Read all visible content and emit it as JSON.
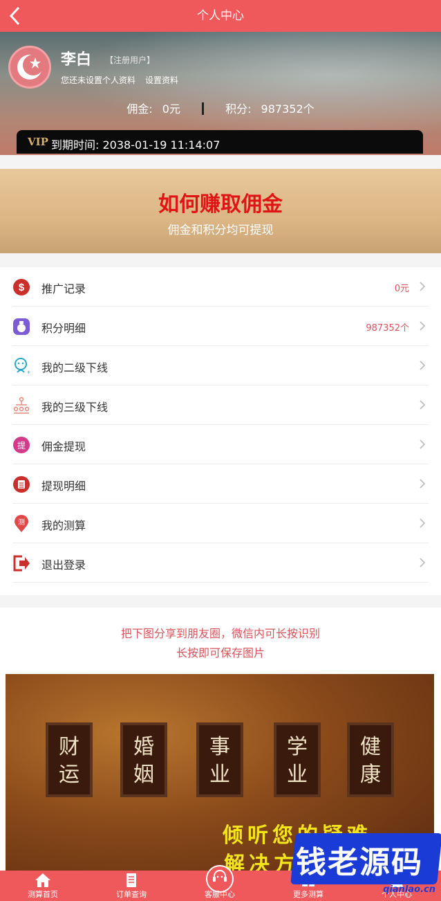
{
  "header": {
    "title": "个人中心"
  },
  "profile": {
    "name": "李白",
    "badge": "【注册用户】",
    "hint": "您还未设置个人资料",
    "setup_link": "设置资料",
    "commission_label": "佣金:",
    "commission_value": "0元",
    "points_label": "积分:",
    "points_value": "987352个",
    "vip_label": "VIP",
    "expire": "到期时间: 2038-01-19 11:14:07"
  },
  "banner": {
    "title": "如何赚取佣金",
    "subtitle": "佣金和积分均可提现"
  },
  "menu": [
    {
      "label": "推广记录",
      "value": "0元",
      "icon": "dollar-icon",
      "color": "#c9302c"
    },
    {
      "label": "积分明细",
      "value": "987352个",
      "icon": "money-bag-icon",
      "color": "#7b5bd6"
    },
    {
      "label": "我的二级下线",
      "value": "",
      "icon": "user-add-icon",
      "color": "#2aa6c7"
    },
    {
      "label": "我的三级下线",
      "value": "",
      "icon": "org-tree-icon",
      "color": "#e5857a"
    },
    {
      "label": "佣金提现",
      "value": "",
      "icon": "withdraw-icon",
      "color": "#d33a8a"
    },
    {
      "label": "提现明细",
      "value": "",
      "icon": "list-icon",
      "color": "#c9302c"
    },
    {
      "label": "我的测算",
      "value": "",
      "icon": "location-pin-icon",
      "color": "#e04848"
    },
    {
      "label": "退出登录",
      "value": "",
      "icon": "logout-icon",
      "color": "#c9302c"
    }
  ],
  "share": {
    "line1": "把下图分享到朋友圈，微信内可长按识别",
    "line2": "长按即可保存图片",
    "boards": [
      {
        "top": "财",
        "bottom": "运"
      },
      {
        "top": "婚",
        "bottom": "姻"
      },
      {
        "top": "事",
        "bottom": "业"
      },
      {
        "top": "学",
        "bottom": "业"
      },
      {
        "top": "健",
        "bottom": "康"
      }
    ],
    "slogan1": "倾听您的疑难",
    "slogan2": "解决方"
  },
  "watermark": {
    "text": "钱老源码",
    "url": "qianlao.cn"
  },
  "tabbar": [
    {
      "label": "测算首页",
      "icon": "home-icon"
    },
    {
      "label": "订单查询",
      "icon": "document-icon"
    },
    {
      "label": "客服中心",
      "icon": "headset-icon"
    },
    {
      "label": "更多测算",
      "icon": "grid-icon"
    },
    {
      "label": "个人中心",
      "icon": "user-icon"
    }
  ]
}
